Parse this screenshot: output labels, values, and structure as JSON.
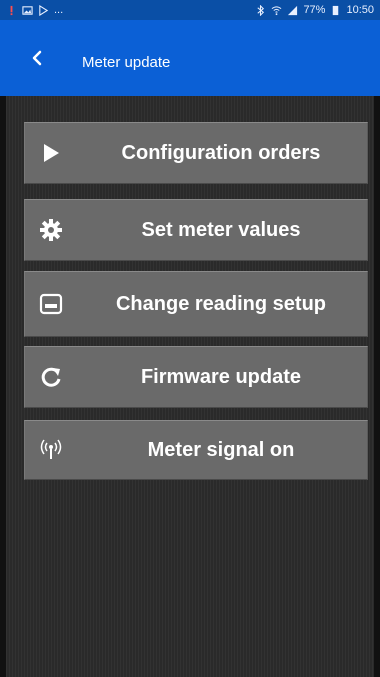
{
  "status_bar": {
    "left_icons": [
      "alert-icon",
      "image-icon",
      "play-store-icon"
    ],
    "ellipsis": "...",
    "battery": "77%",
    "time": "10:50",
    "right_icons": [
      "bluetooth-icon",
      "wifi-icon",
      "signal-icon",
      "battery-icon"
    ]
  },
  "app_bar": {
    "back_icon": "chevron-left-icon",
    "title": "Meter update"
  },
  "menu": [
    {
      "label": "Configuration orders",
      "icon": "play-icon"
    },
    {
      "label": "Set meter values",
      "icon": "gear-icon"
    },
    {
      "label": "Change reading setup",
      "icon": "display-icon"
    },
    {
      "label": "Firmware update",
      "icon": "refresh-icon"
    },
    {
      "label": "Meter signal on",
      "icon": "antenna-icon"
    }
  ],
  "colors": {
    "status_bar": "#0a4fa6",
    "app_bar": "#0b60d6",
    "button": "#6a6a6a",
    "background": "#2a2a2a"
  }
}
